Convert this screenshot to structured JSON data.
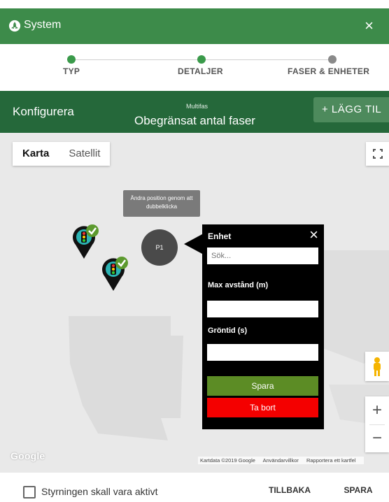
{
  "window": {
    "title": "System",
    "close_label": "×"
  },
  "stepper": {
    "steps": [
      {
        "label": "TYP",
        "state": "done",
        "color": "#3a9a4a"
      },
      {
        "label": "DETALJER",
        "state": "done",
        "color": "#3a9a4a"
      },
      {
        "label": "FASER & ENHETER",
        "state": "current",
        "color": "#8a8a8a"
      }
    ]
  },
  "config": {
    "title": "Konfigurera",
    "mode_small": "Multifas",
    "mode_big": "Obegränsat antal faser",
    "add_label": "+ LÄGG TIL"
  },
  "map": {
    "types": [
      {
        "label": "Karta",
        "active": true
      },
      {
        "label": "Satellit",
        "active": false
      }
    ],
    "tooltip": "Ändra position genom att dubbelklicka",
    "marker_label": "P1",
    "logo": "Google",
    "attribution": [
      "Kartdata ©2019 Google",
      "Användarvillkor",
      "Rapportera ett kartfel"
    ],
    "zoom_in": "+",
    "zoom_out": "−"
  },
  "popup": {
    "title": "Enhet",
    "close": "×",
    "search_placeholder": "Sök...",
    "max_label": "Max avstånd (m)",
    "max_value": "",
    "green_label": "Gröntid (s)",
    "green_value": "",
    "save": "Spara",
    "delete": "Ta bort"
  },
  "footer": {
    "checkbox_label": "Styrningen skall vara aktivt",
    "checked": false,
    "back": "TILLBAKA",
    "save": "SPARA"
  },
  "colors": {
    "primary": "#3d8b4a",
    "dark": "#25683a",
    "save": "#5c8c25",
    "delete": "#f40000"
  }
}
